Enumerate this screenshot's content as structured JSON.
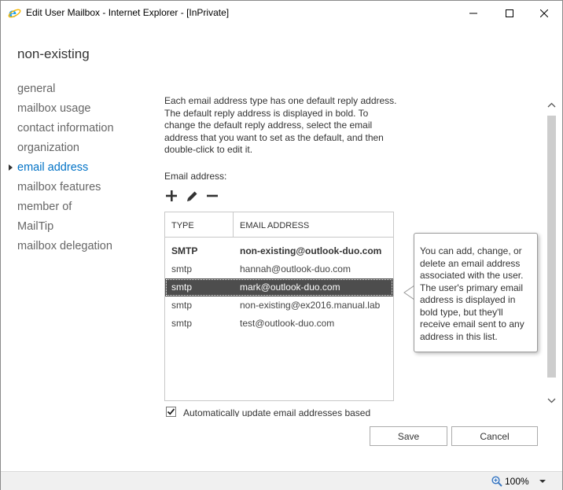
{
  "window": {
    "title": "Edit User Mailbox - Internet Explorer - [InPrivate]"
  },
  "page_title": "non-existing",
  "nav": {
    "items": [
      {
        "label": "general",
        "active": false
      },
      {
        "label": "mailbox usage",
        "active": false
      },
      {
        "label": "contact information",
        "active": false
      },
      {
        "label": "organization",
        "active": false
      },
      {
        "label": "email address",
        "active": true
      },
      {
        "label": "mailbox features",
        "active": false
      },
      {
        "label": "member of",
        "active": false
      },
      {
        "label": "MailTip",
        "active": false
      },
      {
        "label": "mailbox delegation",
        "active": false
      }
    ]
  },
  "main": {
    "description": "Each email address type has one default reply address. The default reply address is displayed in bold. To change the default reply address, select the email address that you want to set as the default, and then double-click to edit it.",
    "email_label": "Email address:",
    "toolbar": {
      "add_icon": "plus-icon",
      "edit_icon": "pencil-icon",
      "remove_icon": "minus-icon"
    },
    "table": {
      "columns": [
        "TYPE",
        "EMAIL ADDRESS"
      ],
      "rows": [
        {
          "type": "SMTP",
          "email": "non-existing@outlook-duo.com",
          "bold": true,
          "selected": false
        },
        {
          "type": "smtp",
          "email": "hannah@outlook-duo.com",
          "bold": false,
          "selected": false
        },
        {
          "type": "smtp",
          "email": "mark@outlook-duo.com",
          "bold": false,
          "selected": true
        },
        {
          "type": "smtp",
          "email": "non-existing@ex2016.manual.lab",
          "bold": false,
          "selected": false
        },
        {
          "type": "smtp",
          "email": "test@outlook-duo.com",
          "bold": false,
          "selected": false
        }
      ]
    },
    "tooltip": "You can add, change, or delete an email address associated with the user. The user's primary email address is displayed in bold type, but they'll receive email sent to any address in this list.",
    "auto_update_label": "Automatically update email addresses based",
    "auto_update_checked": true,
    "save_label": "Save",
    "cancel_label": "Cancel"
  },
  "statusbar": {
    "zoom": "100%"
  },
  "colors": {
    "accent": "#0072c6",
    "selected_row": "#4d4d4d"
  }
}
